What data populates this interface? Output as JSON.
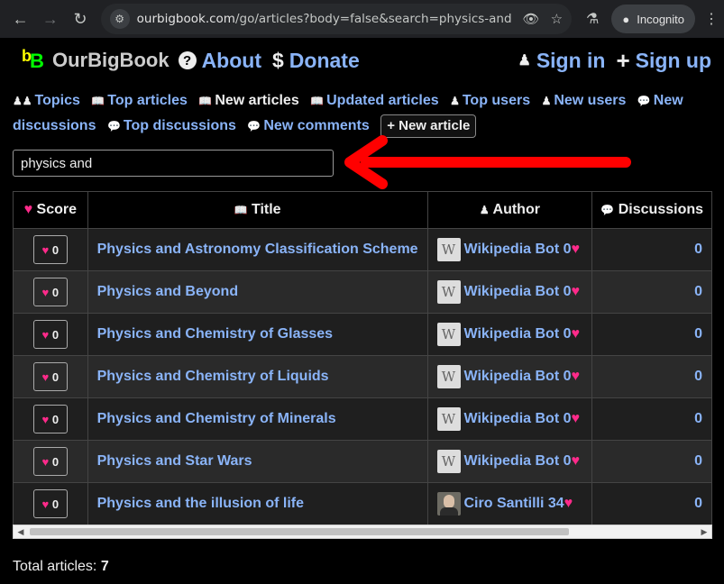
{
  "browser": {
    "url_host": "ourbigbook.com",
    "url_path": "/go/articles?body=false&search=physics-and",
    "incognito_label": "Incognito"
  },
  "header": {
    "brand": "OurBigBook",
    "about": "About",
    "donate": "Donate",
    "sign_in": "Sign in",
    "sign_up": "Sign up"
  },
  "nav": {
    "topics": "Topics",
    "top_articles": "Top articles",
    "new_articles": "New articles",
    "updated_articles": "Updated articles",
    "top_users": "Top users",
    "new_users": "New users",
    "new_discussions": "New discussions",
    "top_discussions": "Top discussions",
    "new_comments": "New comments",
    "new_article_button": "New article"
  },
  "search": {
    "value": "physics and"
  },
  "table": {
    "headers": {
      "score": "Score",
      "title": "Title",
      "author": "Author",
      "discussions": "Discussions"
    },
    "rows": [
      {
        "score": "0",
        "title": "Physics and Astronomy Classification Scheme",
        "author": "Wikipedia Bot 0",
        "avatar": "wikipedia-logo",
        "discussions": "0"
      },
      {
        "score": "0",
        "title": "Physics and Beyond",
        "author": "Wikipedia Bot 0",
        "avatar": "wikipedia-logo",
        "discussions": "0"
      },
      {
        "score": "0",
        "title": "Physics and Chemistry of Glasses",
        "author": "Wikipedia Bot 0",
        "avatar": "wikipedia-logo",
        "discussions": "0"
      },
      {
        "score": "0",
        "title": "Physics and Chemistry of Liquids",
        "author": "Wikipedia Bot 0",
        "avatar": "wikipedia-logo",
        "discussions": "0"
      },
      {
        "score": "0",
        "title": "Physics and Chemistry of Minerals",
        "author": "Wikipedia Bot 0",
        "avatar": "wikipedia-logo",
        "discussions": "0"
      },
      {
        "score": "0",
        "title": "Physics and Star Wars",
        "author": "Wikipedia Bot 0",
        "avatar": "wikipedia-logo",
        "discussions": "0"
      },
      {
        "score": "0",
        "title": "Physics and the illusion of life",
        "author": "Ciro Santilli 34",
        "avatar": "user-photo",
        "discussions": "0"
      }
    ]
  },
  "footer": {
    "total_label": "Total articles:",
    "total_value": "7"
  },
  "colors": {
    "link": "#8ab4f8",
    "heart": "#ff2a8a",
    "annotation_arrow": "#ff0000"
  }
}
